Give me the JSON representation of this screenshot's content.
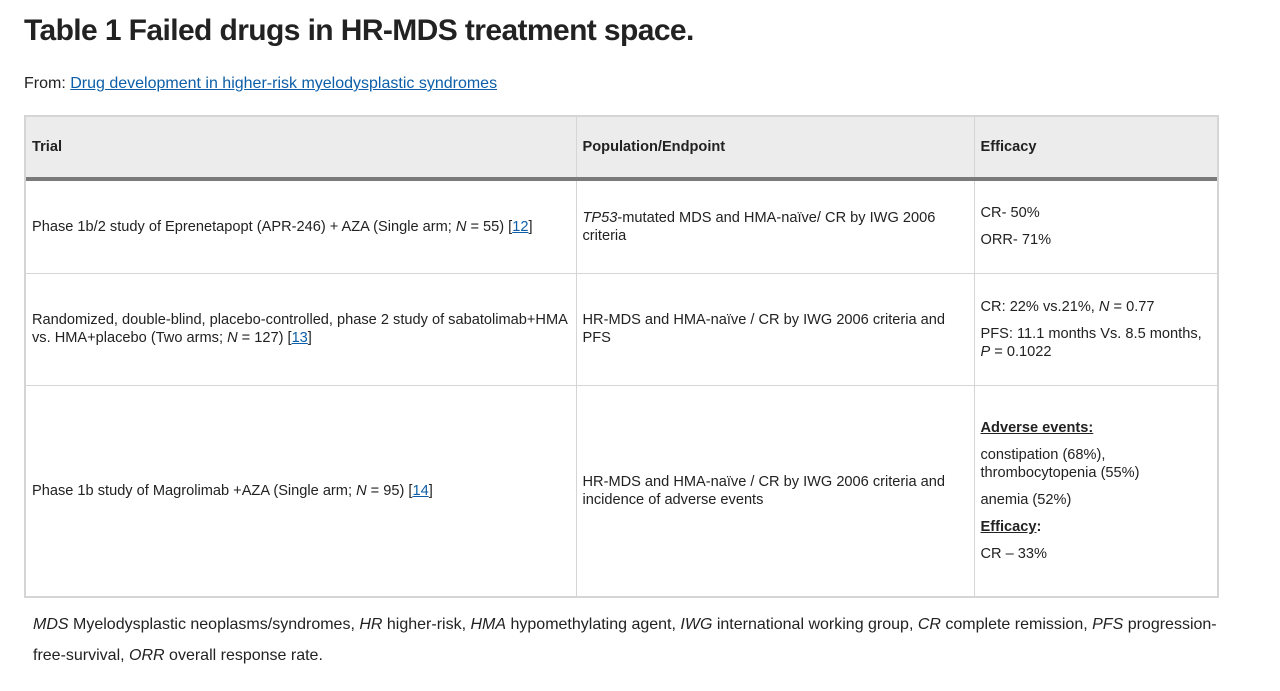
{
  "title": "Table 1 Failed drugs in HR-MDS treatment space.",
  "from": {
    "prefix": "From: ",
    "link_text": "Drug development in higher-risk myelodysplastic syndromes"
  },
  "table": {
    "headers": [
      "Trial",
      "Population/Endpoint",
      "Efficacy"
    ],
    "rows": [
      {
        "trial": {
          "text": "Phase 1b/2 study of Eprenetapopt (APR-246) + AZA (Single arm; ",
          "n_label": "N",
          "n_value": " = 55) [",
          "ref": "12",
          "close": "]"
        },
        "population": {
          "italic_lead": "TP53",
          "rest": "-mutated MDS and HMA-naïve/ CR by IWG 2006 criteria"
        },
        "efficacy": [
          "CR- 50%",
          "ORR- 71%"
        ]
      },
      {
        "trial": {
          "text": "Randomized, double-blind, placebo-controlled, phase 2 study of sabatolimab+HMA vs. HMA+placebo (Two arms; ",
          "n_label": "N",
          "n_value": " = 127) [",
          "ref": "13",
          "close": "]"
        },
        "population": {
          "italic_lead": "",
          "rest": "HR-MDS and HMA-naïve / CR by IWG 2006 criteria and PFS"
        },
        "efficacy_parts": {
          "line1_a": "CR: 22% vs.21%, ",
          "line1_n": "N",
          "line1_b": " = 0.77",
          "line2_a": "PFS: 11.1 months Vs. 8.5 months, ",
          "line2_p": "P",
          "line2_b": " = 0.1022"
        }
      },
      {
        "trial": {
          "text": "Phase 1b study of Magrolimab +AZA (Single arm; ",
          "n_label": "N",
          "n_value": " = 95) [",
          "ref": "14",
          "close": "]"
        },
        "population": {
          "italic_lead": "",
          "rest": "HR-MDS and HMA-naïve / CR by IWG 2006 criteria and incidence of adverse events"
        },
        "efficacy_block": {
          "ae_heading": "Adverse events:",
          "ae_line1": "constipation (68%), thrombocytopenia (55%)",
          "ae_line2": "anemia (52%)",
          "eff_heading": "Efficacy",
          "eff_colon": ":",
          "eff_line": "CR – 33%"
        }
      }
    ]
  },
  "footnote": [
    {
      "abbr": "MDS",
      "def": " Myelodysplastic neoplasms/syndromes, "
    },
    {
      "abbr": "HR",
      "def": " higher-risk, "
    },
    {
      "abbr": "HMA",
      "def": " hypomethylating agent, "
    },
    {
      "abbr": "IWG",
      "def": " international working group, "
    },
    {
      "abbr": "CR",
      "def": " complete remission, "
    },
    {
      "abbr": "PFS",
      "def": " progression-free-survival, "
    },
    {
      "abbr": "ORR",
      "def": " overall response rate."
    }
  ]
}
